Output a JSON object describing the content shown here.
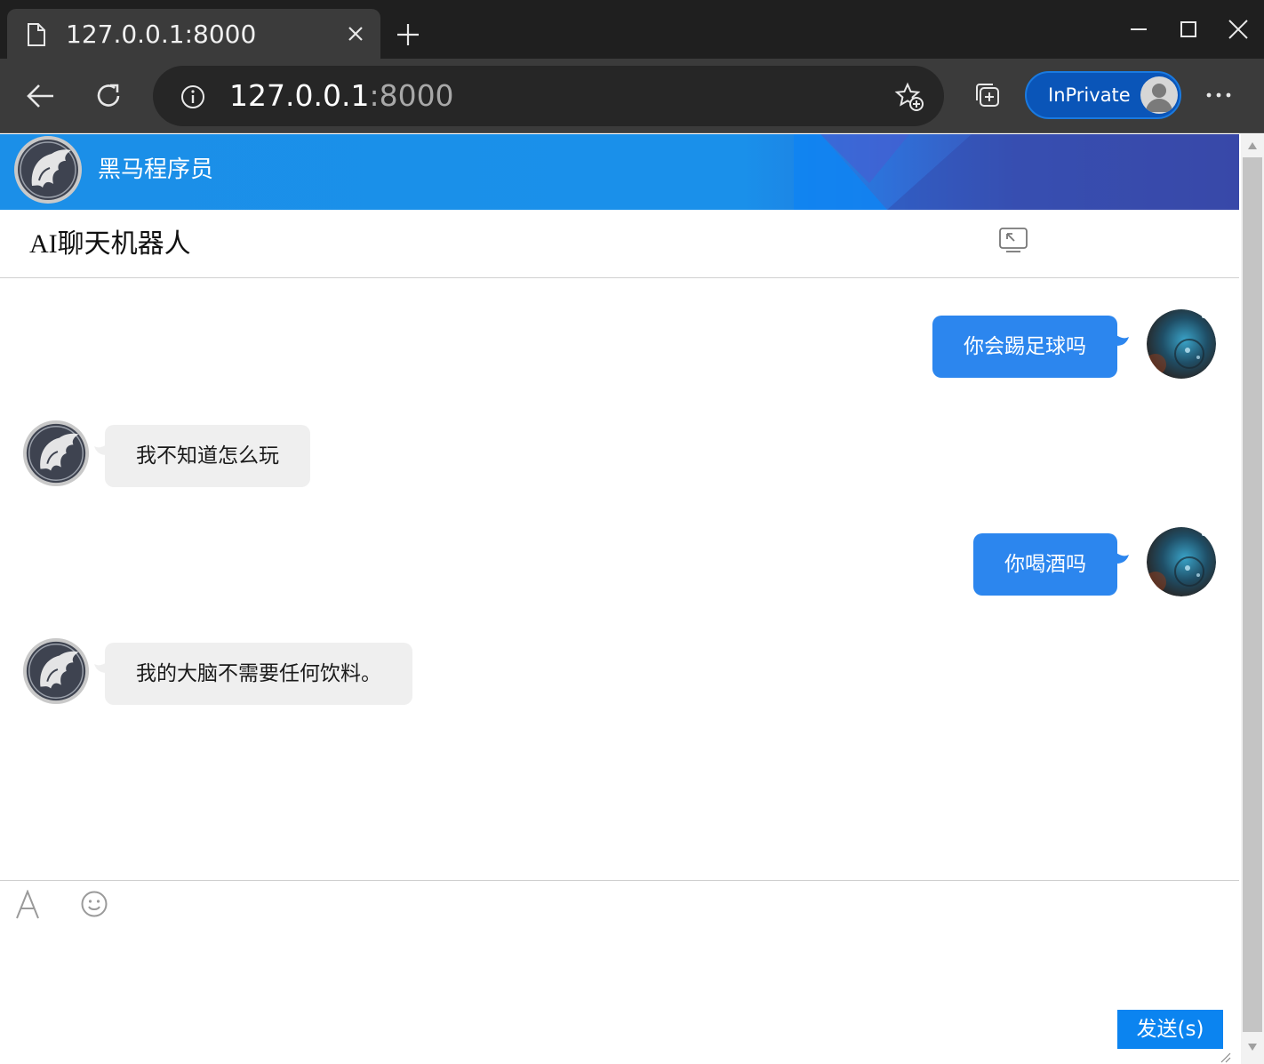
{
  "browser": {
    "tab_title": "127.0.0.1:8000",
    "url_host": "127.0.0.1",
    "url_port": ":8000",
    "inprivate_label": "InPrivate"
  },
  "page": {
    "brand": "黑马程序员",
    "chat_title": "AI聊天机器人",
    "messages": [
      {
        "role": "user",
        "text": "你会踢足球吗"
      },
      {
        "role": "bot",
        "text": "我不知道怎么玩"
      },
      {
        "role": "user",
        "text": "你喝酒吗"
      },
      {
        "role": "bot",
        "text": "我的大脑不需要任何饮料。"
      }
    ],
    "input_value": "",
    "send_label": "发送(s)"
  },
  "colors": {
    "banner": "#1b8fe8",
    "user_bubble": "#2c86ee",
    "bot_bubble": "#efefef",
    "send_button": "#0b84f0"
  }
}
